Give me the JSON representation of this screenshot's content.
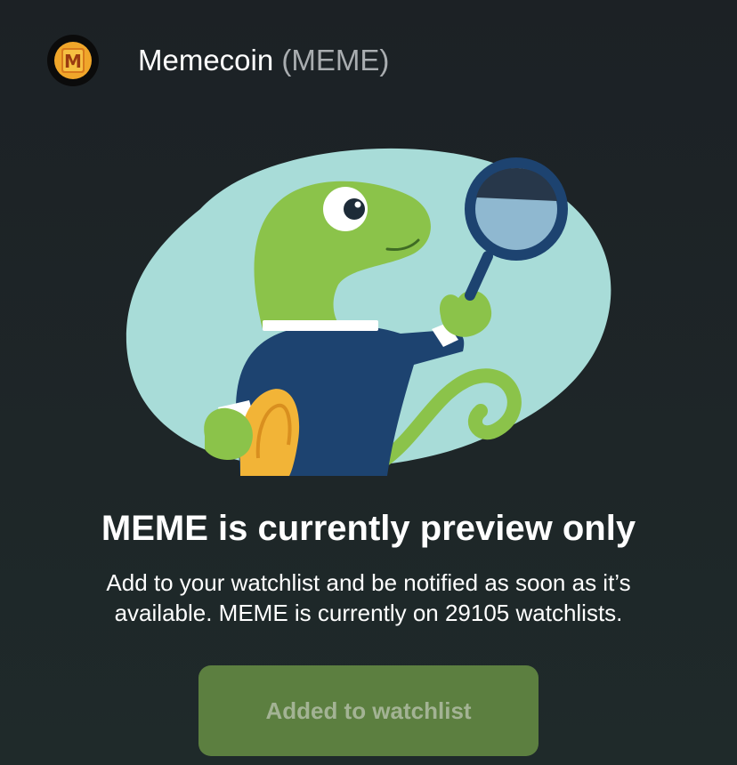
{
  "header": {
    "coin_name": "Memecoin",
    "coin_ticker": "(MEME)",
    "logo_letter": "M",
    "logo_icon": "memecoin-logo-icon"
  },
  "hero": {
    "illustration": "gecko-with-magnifying-glass-illustration",
    "colors": {
      "blob": "#a8dcd8",
      "gecko": "#8bc34a",
      "suit": "#1d4370",
      "coin": "#f2b437"
    }
  },
  "main": {
    "headline": "MEME is currently preview only",
    "description": "Add to your watchlist and be notified as soon as it’s available. MEME is currently on 29105 watchlists."
  },
  "watchlist_button": {
    "label": "Added to watchlist",
    "color": "#5c7f40"
  }
}
